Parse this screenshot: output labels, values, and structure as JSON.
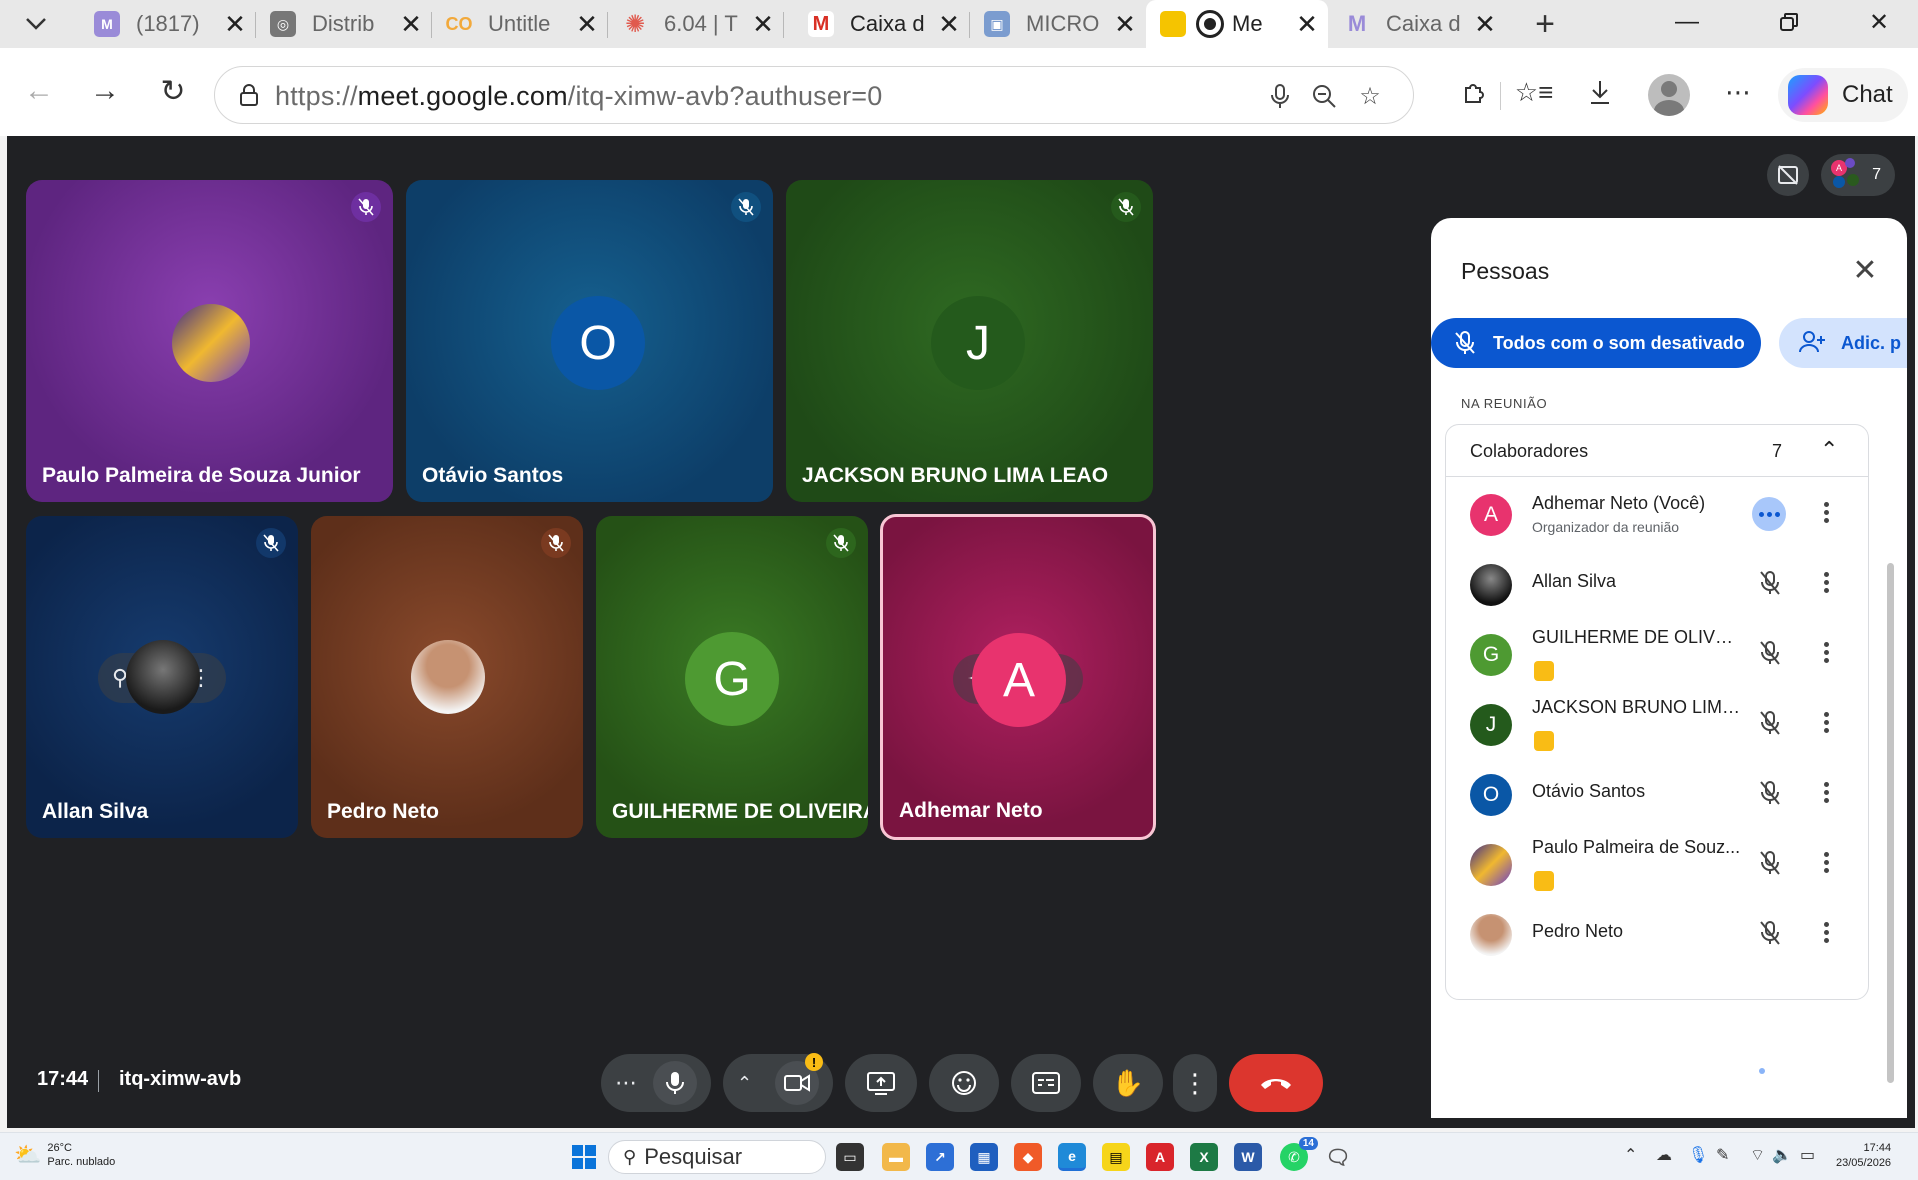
{
  "browser": {
    "tabs": [
      {
        "title": "(1817)",
        "favicon": "gmail-icon"
      },
      {
        "title": "Distrib",
        "favicon": "distrib-icon"
      },
      {
        "title": "Untitle",
        "favicon": "co-icon"
      },
      {
        "title": "6.04 | T",
        "favicon": "canvas-icon"
      },
      {
        "title": "Caixa d",
        "favicon": "gmail-icon"
      },
      {
        "title": "MICRO",
        "favicon": "contact-icon"
      },
      {
        "title": "Me",
        "favicon": "meet-icon",
        "active": true
      },
      {
        "title": "Caixa d",
        "favicon": "gmail-icon"
      }
    ],
    "url_prefix": "https://",
    "url_host": "meet.google.com",
    "url_path": "/itq-ximw-avb?authuser=0",
    "chat_label": "Chat"
  },
  "meet": {
    "participant_count": "7",
    "tiles": [
      {
        "name": "Paulo Palmeira de Souza Junior",
        "initial": "",
        "color": "#6b2a8c"
      },
      {
        "name": "Otávio Santos",
        "initial": "O",
        "color": "#0d4a7a"
      },
      {
        "name": "JACKSON BRUNO LIMA LEAO",
        "initial": "J",
        "color": "#2a5a1e"
      },
      {
        "name": "Allan Silva",
        "initial": "",
        "color": "#0f2a55"
      },
      {
        "name": "Pedro Neto",
        "initial": "",
        "color": "#6e3a22"
      },
      {
        "name": "GUILHERME DE OLIVEIRA C...",
        "initial": "G",
        "color": "#2f6a1a"
      },
      {
        "name": "Adhemar Neto",
        "initial": "A",
        "color": "#9a1a4e"
      }
    ],
    "panel": {
      "title": "Pessoas",
      "mute_all_label": "Todos com o som desativado",
      "add_label": "Adic. p",
      "section_label": "NA REUNIÃO",
      "group_title": "Colaboradores",
      "group_count": "7",
      "people": [
        {
          "name": "Adhemar Neto (Você)",
          "subtitle": "Organizador da reunião",
          "initial": "A",
          "color": "#e8336e"
        },
        {
          "name": "Allan Silva",
          "subtitle": "",
          "initial": "",
          "color": "#2b2b2b"
        },
        {
          "name": "GUILHERME DE OLIVEIR...",
          "subtitle": "",
          "initial": "G",
          "color": "#3f8e2a"
        },
        {
          "name": "JACKSON BRUNO LIMA...",
          "subtitle": "",
          "initial": "J",
          "color": "#2a5a1e"
        },
        {
          "name": "Otávio Santos",
          "subtitle": "",
          "initial": "O",
          "color": "#0a57a6"
        },
        {
          "name": "Paulo Palmeira de Souz...",
          "subtitle": "",
          "initial": "",
          "color": "#6b4bc4"
        },
        {
          "name": "Pedro Neto",
          "subtitle": "",
          "initial": "",
          "color": "#c89a7a"
        }
      ]
    },
    "clock": "17:44",
    "meeting_code": "itq-ximw-avb"
  },
  "taskbar": {
    "weather_temp": "26°C",
    "weather_desc": "Parc. nublado",
    "search_label": "Pesquisar",
    "whatsapp_badge": "14",
    "time": "17:44",
    "date": "23/05/2026"
  }
}
